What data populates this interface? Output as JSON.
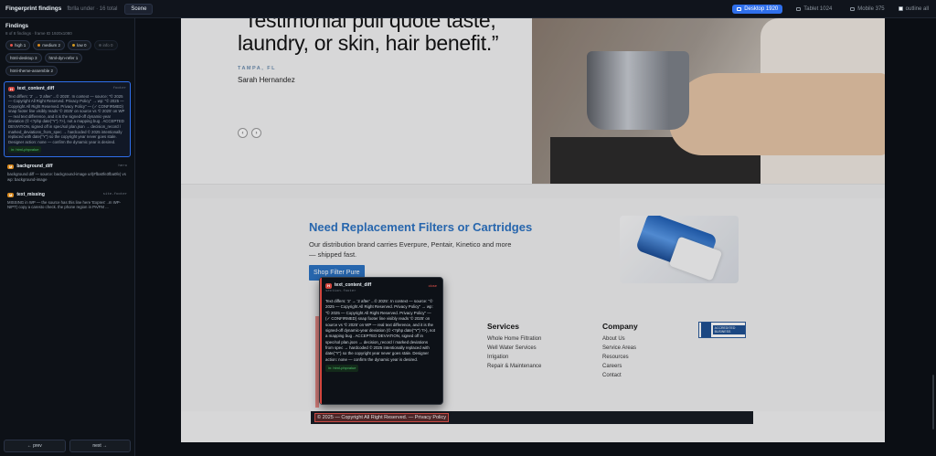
{
  "topbar": {
    "title": "Fingerprint findings",
    "meta": "fbrlla under · 16 total",
    "tab": "Scene",
    "viewports": [
      {
        "label": "Desktop 1920",
        "active": true
      },
      {
        "label": "Tablet 1024",
        "active": false
      },
      {
        "label": "Mobile 375",
        "active": false
      }
    ],
    "outline_label": "outline all"
  },
  "sidebar": {
    "heading": "Findings",
    "subheading": "8 of 8 findings · frame ID 1920x1080",
    "chips": [
      {
        "label": "high 1",
        "color": "#e5534b"
      },
      {
        "label": "medium 2",
        "color": "#d98a1f"
      },
      {
        "label": "low 0",
        "color": "#d29922"
      },
      {
        "label": "info 0",
        "color": "#6e7681",
        "dim": true
      },
      {
        "label": "html-desktop 3"
      },
      {
        "label": "html-dyn-refer 1"
      },
      {
        "label": "html-theme-assemble 2"
      }
    ],
    "findings": [
      {
        "badge": "H",
        "title": "text_content_diff",
        "selector": "footer",
        "body": "Text differs: '2' → '2 after' ...© 2025'. In context — source: \"© 2025 — Copyright All Right Reserved. Privacy Policy\" → wp: \"© 2025 — Copyright All Right Reserved. Privacy Policy\" — (✓ CONFIRMED) snap footer line visibly reads '© 2025' on source vs '© 2025' on WP — real text difference, and it is the signed-off dynamic-year deviation (© <?php date(\"Y\") ?>), not a mapping bug . ACCEPTED DEVIATION, signed off in spec/sol plan.json → decision_record / marked_deviations_from_spec → hardcoded © 2025 intentionally replaced with date(\"Y\") so the copyright year never goes stale. Designer action: none — confirm the dynamic year is desired.",
        "tag": "in: html-phpvalue",
        "selected": true
      },
      {
        "badge": "M",
        "title": "background_diff",
        "selector": "hero",
        "body": "background diff — source: background-image url(#fba0fe3fba0fe) vs wp: background-image",
        "selected": false
      },
      {
        "badge": "M",
        "title": "text_missing",
        "selector": "site-footer",
        "body": "MISSING in WP — the source has this line here 'Expres' ..m WP-NIPT) copy a caresto check. the phone region in PA/FM ...",
        "selected": false
      }
    ],
    "prev_label": "← prev",
    "next_label": "next →"
  },
  "page": {
    "quote": "“Testimonial pull quote taste, laundry, or skin, hair benefit.”",
    "city": "TAMPA, FL",
    "author": "Sarah Hernandez",
    "prev_arrow": "‹",
    "next_arrow": "›",
    "promo_title": "Need Replacement Filters or Cartridges",
    "promo_desc": "Our distribution brand carries Everpure, Pentair, Kinetico and more — shipped fast.",
    "shop_button": "Shop Filter Pure",
    "columns": [
      {
        "heading": "Services",
        "items": [
          "Whole Home Filtration",
          "Well Water Services",
          "Irrigation",
          "Repair & Maintenance"
        ]
      },
      {
        "heading": "Company",
        "items": [
          "About Us",
          "Service Areas",
          "Resources",
          "Careers",
          "Contact"
        ]
      }
    ],
    "bbb_label": "ACCREDITED BUSINESS",
    "copyright": "© 2025 — Copyright All Right Reserved. — Privacy Policy"
  },
  "popup": {
    "badge": "H",
    "title": "text_content_diff",
    "close": "close",
    "selector": "section.footer",
    "body": "Text differs: '2' → '2 after' ...© 2025'. In context — source: \"© 2025 — Copyright All Right Reserved. Privacy Policy\" → wp: \"© 2025 — Copyright All Right Reserved. Privacy Policy\" — (✓ CONFIRMED) snap footer line visibly reads '© 2025' on source vs '© 2025' on WP — real text difference, and it is the signed-off dynamic-year deviation (© <?php date(\"Y\") ?>), not a mapping bug . ACCEPTED DEVIATION, signed off in spec/sol plan.json → decision_record / marked deviations from spec → hardcoded © 2025 intentionally replaced with date(\"Y\") so the copyright year never goes stale. Designer action: none — confirm the dynamic year is desired.",
    "tag": "in: html-phpvalue"
  }
}
